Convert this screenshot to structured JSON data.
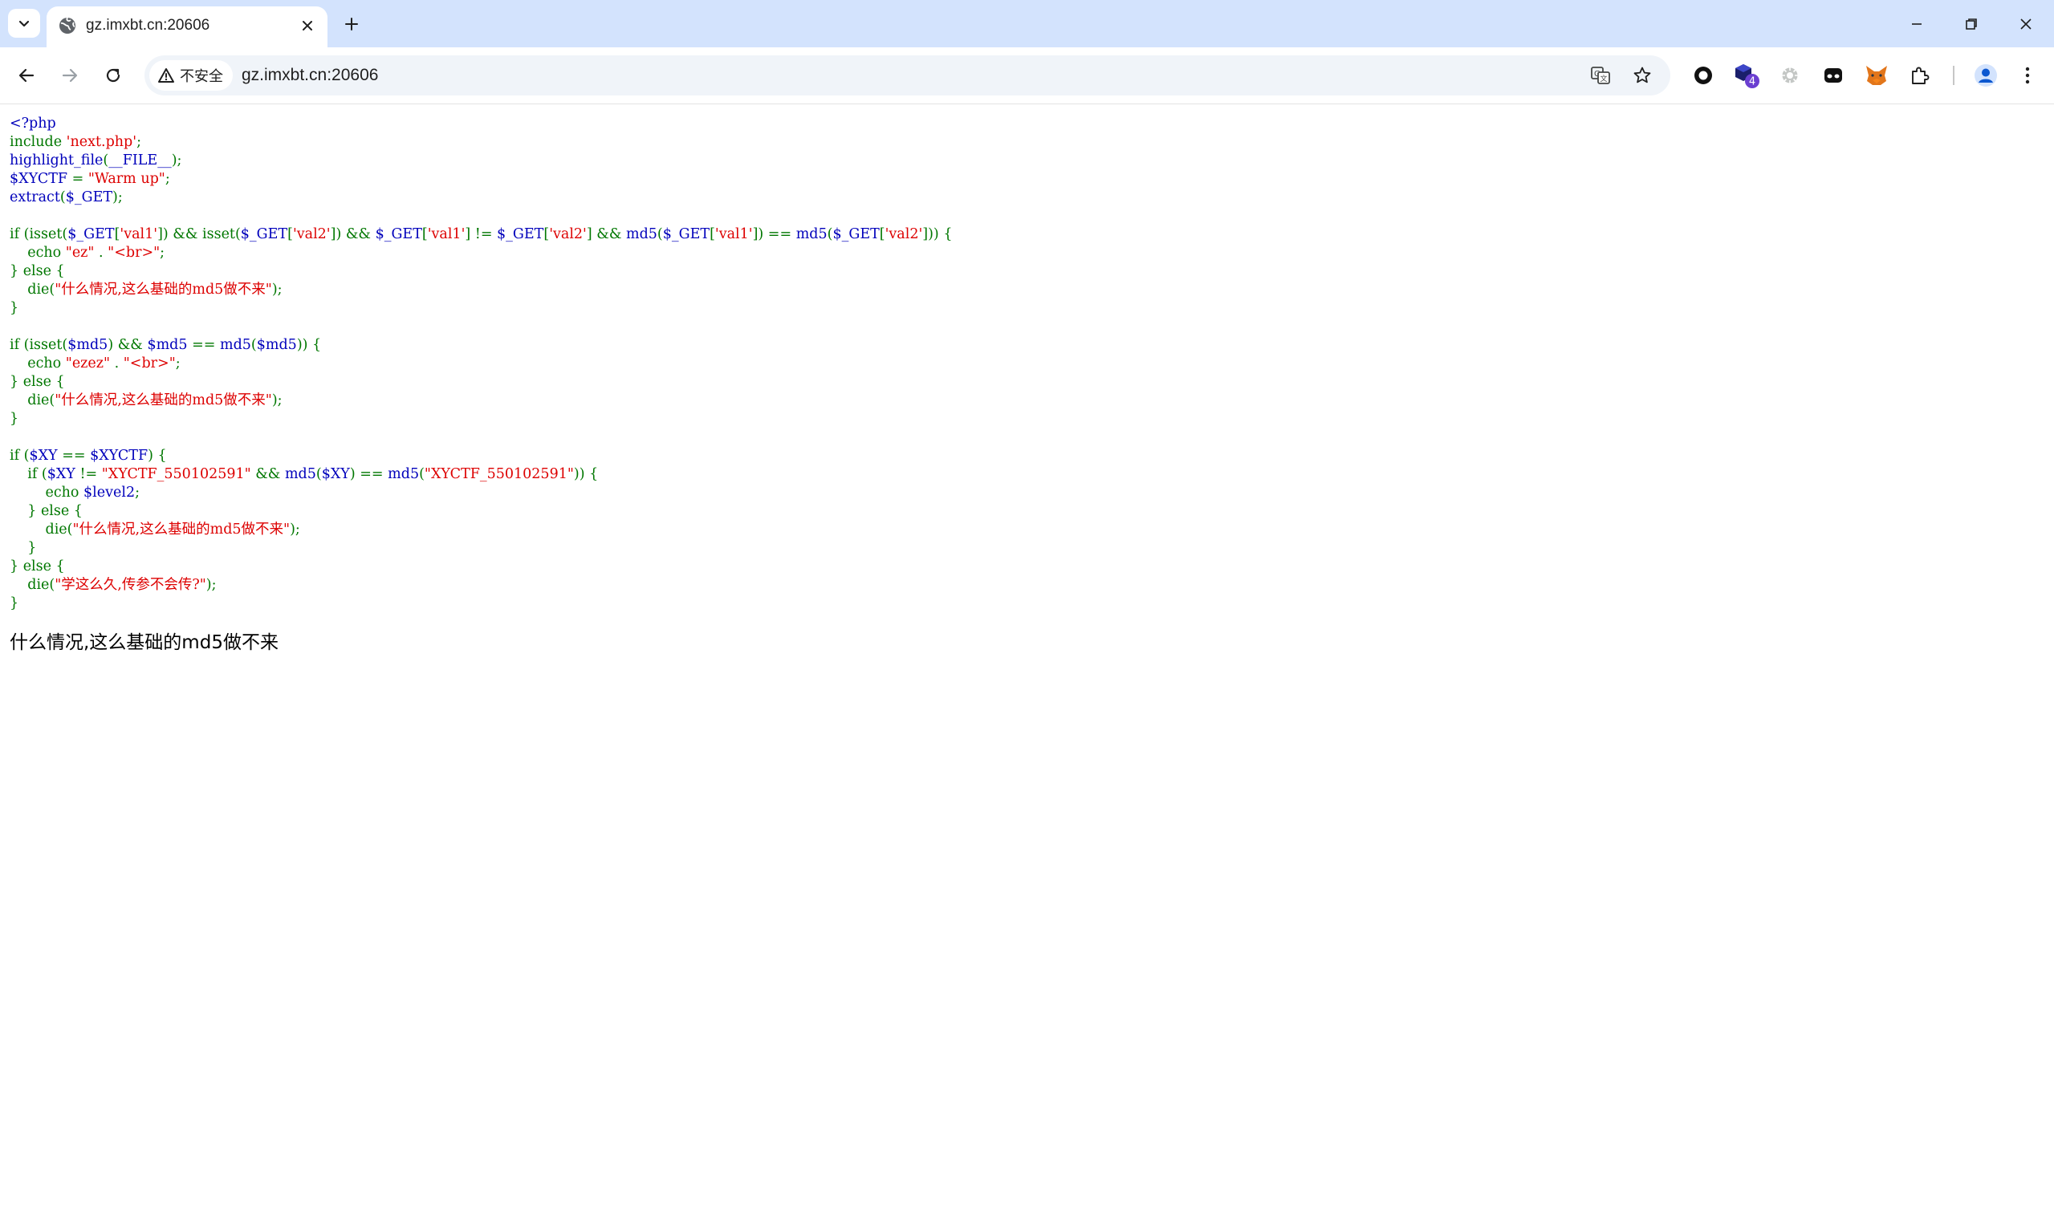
{
  "browser": {
    "tab": {
      "title": "gz.imxbt.cn:20606"
    },
    "omnibox": {
      "security_label": "不安全",
      "url": "gz.imxbt.cn:20606"
    },
    "extensions": {
      "badge_count": "4"
    },
    "colors": {
      "tabstrip_bg": "#d3e3fd",
      "omnibox_bg": "#f0f4f9"
    }
  },
  "code": {
    "colors": {
      "keyword_default": "#007700",
      "identifier": "#0000bb",
      "string": "#dd0000"
    },
    "lines": [
      [
        {
          "t": "<?php",
          "c": "blue"
        }
      ],
      [
        {
          "t": "include ",
          "c": "green"
        },
        {
          "t": "'next.php'",
          "c": "red"
        },
        {
          "t": ";",
          "c": "green"
        }
      ],
      [
        {
          "t": "highlight_file",
          "c": "blue"
        },
        {
          "t": "(",
          "c": "green"
        },
        {
          "t": "__FILE__",
          "c": "blue"
        },
        {
          "t": ");",
          "c": "green"
        }
      ],
      [
        {
          "t": "$XYCTF ",
          "c": "blue"
        },
        {
          "t": "= ",
          "c": "green"
        },
        {
          "t": "\"Warm up\"",
          "c": "red"
        },
        {
          "t": ";",
          "c": "green"
        }
      ],
      [
        {
          "t": "extract",
          "c": "blue"
        },
        {
          "t": "(",
          "c": "green"
        },
        {
          "t": "$_GET",
          "c": "blue"
        },
        {
          "t": ");",
          "c": "green"
        }
      ],
      [],
      [
        {
          "t": "if (isset(",
          "c": "green"
        },
        {
          "t": "$_GET",
          "c": "blue"
        },
        {
          "t": "[",
          "c": "green"
        },
        {
          "t": "'val1'",
          "c": "red"
        },
        {
          "t": "]) && isset(",
          "c": "green"
        },
        {
          "t": "$_GET",
          "c": "blue"
        },
        {
          "t": "[",
          "c": "green"
        },
        {
          "t": "'val2'",
          "c": "red"
        },
        {
          "t": "]) && ",
          "c": "green"
        },
        {
          "t": "$_GET",
          "c": "blue"
        },
        {
          "t": "[",
          "c": "green"
        },
        {
          "t": "'val1'",
          "c": "red"
        },
        {
          "t": "] != ",
          "c": "green"
        },
        {
          "t": "$_GET",
          "c": "blue"
        },
        {
          "t": "[",
          "c": "green"
        },
        {
          "t": "'val2'",
          "c": "red"
        },
        {
          "t": "] && ",
          "c": "green"
        },
        {
          "t": "md5",
          "c": "blue"
        },
        {
          "t": "(",
          "c": "green"
        },
        {
          "t": "$_GET",
          "c": "blue"
        },
        {
          "t": "[",
          "c": "green"
        },
        {
          "t": "'val1'",
          "c": "red"
        },
        {
          "t": "]) == ",
          "c": "green"
        },
        {
          "t": "md5",
          "c": "blue"
        },
        {
          "t": "(",
          "c": "green"
        },
        {
          "t": "$_GET",
          "c": "blue"
        },
        {
          "t": "[",
          "c": "green"
        },
        {
          "t": "'val2'",
          "c": "red"
        },
        {
          "t": "])) {",
          "c": "green"
        }
      ],
      [
        {
          "t": "    echo ",
          "c": "green"
        },
        {
          "t": "\"ez\" ",
          "c": "red"
        },
        {
          "t": ". ",
          "c": "green"
        },
        {
          "t": "\"<br>\"",
          "c": "red"
        },
        {
          "t": ";",
          "c": "green"
        }
      ],
      [
        {
          "t": "} else {",
          "c": "green"
        }
      ],
      [
        {
          "t": "    die(",
          "c": "green"
        },
        {
          "t": "\"什么情况,这么基础的md5做不来\"",
          "c": "red"
        },
        {
          "t": ");",
          "c": "green"
        }
      ],
      [
        {
          "t": "}",
          "c": "green"
        }
      ],
      [],
      [
        {
          "t": "if (isset(",
          "c": "green"
        },
        {
          "t": "$md5",
          "c": "blue"
        },
        {
          "t": ") && ",
          "c": "green"
        },
        {
          "t": "$md5 ",
          "c": "blue"
        },
        {
          "t": "== ",
          "c": "green"
        },
        {
          "t": "md5",
          "c": "blue"
        },
        {
          "t": "(",
          "c": "green"
        },
        {
          "t": "$md5",
          "c": "blue"
        },
        {
          "t": ")) {",
          "c": "green"
        }
      ],
      [
        {
          "t": "    echo ",
          "c": "green"
        },
        {
          "t": "\"ezez\" ",
          "c": "red"
        },
        {
          "t": ". ",
          "c": "green"
        },
        {
          "t": "\"<br>\"",
          "c": "red"
        },
        {
          "t": ";",
          "c": "green"
        }
      ],
      [
        {
          "t": "} else {",
          "c": "green"
        }
      ],
      [
        {
          "t": "    die(",
          "c": "green"
        },
        {
          "t": "\"什么情况,这么基础的md5做不来\"",
          "c": "red"
        },
        {
          "t": ");",
          "c": "green"
        }
      ],
      [
        {
          "t": "}",
          "c": "green"
        }
      ],
      [],
      [
        {
          "t": "if (",
          "c": "green"
        },
        {
          "t": "$XY ",
          "c": "blue"
        },
        {
          "t": "== ",
          "c": "green"
        },
        {
          "t": "$XYCTF",
          "c": "blue"
        },
        {
          "t": ") {",
          "c": "green"
        }
      ],
      [
        {
          "t": "    if (",
          "c": "green"
        },
        {
          "t": "$XY ",
          "c": "blue"
        },
        {
          "t": "!= ",
          "c": "green"
        },
        {
          "t": "\"XYCTF_550102591\" ",
          "c": "red"
        },
        {
          "t": "&& ",
          "c": "green"
        },
        {
          "t": "md5",
          "c": "blue"
        },
        {
          "t": "(",
          "c": "green"
        },
        {
          "t": "$XY",
          "c": "blue"
        },
        {
          "t": ") == ",
          "c": "green"
        },
        {
          "t": "md5",
          "c": "blue"
        },
        {
          "t": "(",
          "c": "green"
        },
        {
          "t": "\"XYCTF_550102591\"",
          "c": "red"
        },
        {
          "t": ")) {",
          "c": "green"
        }
      ],
      [
        {
          "t": "        echo ",
          "c": "green"
        },
        {
          "t": "$level2",
          "c": "blue"
        },
        {
          "t": ";",
          "c": "green"
        }
      ],
      [
        {
          "t": "    } else {",
          "c": "green"
        }
      ],
      [
        {
          "t": "        die(",
          "c": "green"
        },
        {
          "t": "\"什么情况,这么基础的md5做不来\"",
          "c": "red"
        },
        {
          "t": ");",
          "c": "green"
        }
      ],
      [
        {
          "t": "    }",
          "c": "green"
        }
      ],
      [
        {
          "t": "} else {",
          "c": "green"
        }
      ],
      [
        {
          "t": "    die(",
          "c": "green"
        },
        {
          "t": "\"学这么久,传参不会传?\"",
          "c": "red"
        },
        {
          "t": ");",
          "c": "green"
        }
      ],
      [
        {
          "t": "}",
          "c": "green"
        }
      ]
    ]
  },
  "output": {
    "text": "什么情况,这么基础的md5做不来"
  }
}
